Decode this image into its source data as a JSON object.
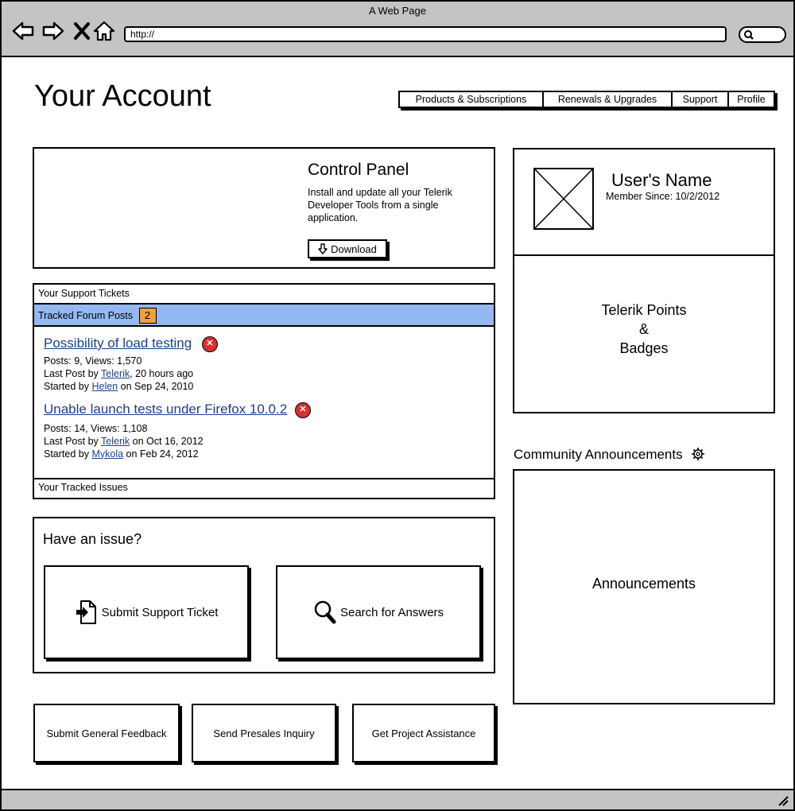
{
  "window": {
    "title": "A Web Page",
    "url": "http://"
  },
  "page": {
    "title": "Your Account"
  },
  "tabs": [
    {
      "label": "Products & Subscriptions"
    },
    {
      "label": "Renewals & Upgrades"
    },
    {
      "label": "Support"
    },
    {
      "label": "Profile"
    }
  ],
  "control_panel": {
    "title": "Control Panel",
    "description": "Install and update all your Telerik Developer Tools from a single application.",
    "download_label": "Download"
  },
  "support": {
    "tickets_label": "Your Support Tickets",
    "forum_label": "Tracked Forum Posts",
    "forum_count": "2",
    "issues_label": "Your Tracked Issues",
    "posts": [
      {
        "title": "Possibility of load testing",
        "stats": "Posts: 9, Views: 1,570",
        "last_post_prefix": "Last Post by",
        "last_post_user": "Telerik",
        "last_post_when": ", 20 hours ago",
        "started_prefix": "Started by",
        "started_user": "Helen",
        "started_when": "on Sep 24, 2010"
      },
      {
        "title": "Unable launch tests under Firefox 10.0.2",
        "stats": "Posts: 14, Views: 1,108",
        "last_post_prefix": "Last Post by",
        "last_post_user": "Telerik",
        "last_post_when": "on Oct 16, 2012",
        "started_prefix": "Started by",
        "started_user": "Mykola",
        "started_when": "on Feb 24, 2012"
      }
    ]
  },
  "issue": {
    "title": "Have an issue?",
    "submit_ticket": "Submit Support Ticket",
    "search_answers": "Search for Answers"
  },
  "footer_buttons": {
    "feedback": "Submit General Feedback",
    "presales": "Send Presales Inquiry",
    "assistance": "Get Project Assistance"
  },
  "user": {
    "name": "User's Name",
    "member_since": "Member Since: 10/2/2012",
    "points_line1": "Telerik Points",
    "points_line2": "&",
    "points_line3": "Badges"
  },
  "announcements": {
    "heading": "Community Announcements",
    "body": "Announcements"
  },
  "colors": {
    "highlight": "#94b8f0",
    "badge": "#f0a040",
    "close": "#d9302e",
    "link": "#1a3f8f"
  }
}
